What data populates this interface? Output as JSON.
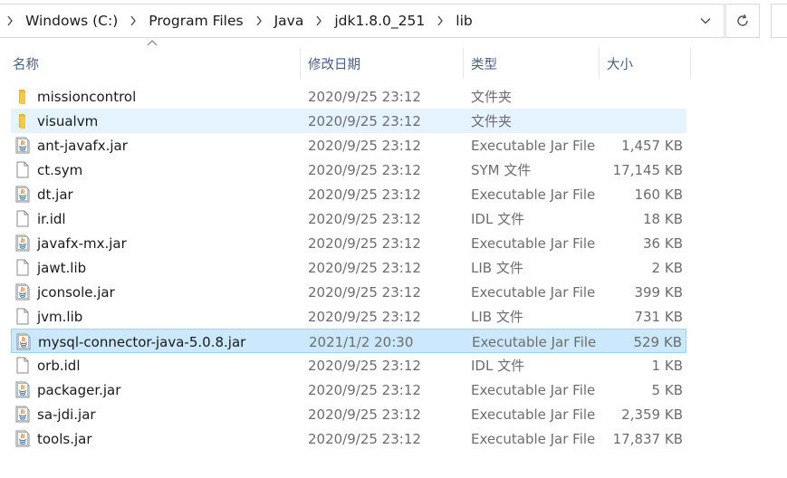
{
  "breadcrumb": [
    "Windows (C:)",
    "Program Files",
    "Java",
    "jdk1.8.0_251",
    "lib"
  ],
  "columns": {
    "name": "名称",
    "date": "修改日期",
    "type": "类型",
    "size": "大小"
  },
  "files": [
    {
      "name": "missioncontrol",
      "date": "2020/9/25 23:12",
      "type": "文件夹",
      "size": "",
      "icon": "folder-icon",
      "state": ""
    },
    {
      "name": "visualvm",
      "date": "2020/9/25 23:12",
      "type": "文件夹",
      "size": "",
      "icon": "folder-icon",
      "state": "hover"
    },
    {
      "name": "ant-javafx.jar",
      "date": "2020/9/25 23:12",
      "type": "Executable Jar File",
      "size": "1,457 KB",
      "icon": "java-jar-icon",
      "state": ""
    },
    {
      "name": "ct.sym",
      "date": "2020/9/25 23:12",
      "type": "SYM 文件",
      "size": "17,145 KB",
      "icon": "file-icon",
      "state": ""
    },
    {
      "name": "dt.jar",
      "date": "2020/9/25 23:12",
      "type": "Executable Jar File",
      "size": "160 KB",
      "icon": "java-jar-icon",
      "state": ""
    },
    {
      "name": "ir.idl",
      "date": "2020/9/25 23:12",
      "type": "IDL 文件",
      "size": "18 KB",
      "icon": "file-icon",
      "state": ""
    },
    {
      "name": "javafx-mx.jar",
      "date": "2020/9/25 23:12",
      "type": "Executable Jar File",
      "size": "36 KB",
      "icon": "java-jar-icon",
      "state": ""
    },
    {
      "name": "jawt.lib",
      "date": "2020/9/25 23:12",
      "type": "LIB 文件",
      "size": "2 KB",
      "icon": "file-icon",
      "state": ""
    },
    {
      "name": "jconsole.jar",
      "date": "2020/9/25 23:12",
      "type": "Executable Jar File",
      "size": "399 KB",
      "icon": "java-jar-icon",
      "state": ""
    },
    {
      "name": "jvm.lib",
      "date": "2020/9/25 23:12",
      "type": "LIB 文件",
      "size": "731 KB",
      "icon": "file-icon",
      "state": ""
    },
    {
      "name": "mysql-connector-java-5.0.8.jar",
      "date": "2021/1/2 20:30",
      "type": "Executable Jar File",
      "size": "529 KB",
      "icon": "java-jar-icon",
      "state": "selected"
    },
    {
      "name": "orb.idl",
      "date": "2020/9/25 23:12",
      "type": "IDL 文件",
      "size": "1 KB",
      "icon": "file-icon",
      "state": ""
    },
    {
      "name": "packager.jar",
      "date": "2020/9/25 23:12",
      "type": "Executable Jar File",
      "size": "5 KB",
      "icon": "java-jar-icon",
      "state": ""
    },
    {
      "name": "sa-jdi.jar",
      "date": "2020/9/25 23:12",
      "type": "Executable Jar File",
      "size": "2,359 KB",
      "icon": "java-jar-icon",
      "state": ""
    },
    {
      "name": "tools.jar",
      "date": "2020/9/25 23:12",
      "type": "Executable Jar File",
      "size": "17,837 KB",
      "icon": "java-jar-icon",
      "state": ""
    }
  ]
}
